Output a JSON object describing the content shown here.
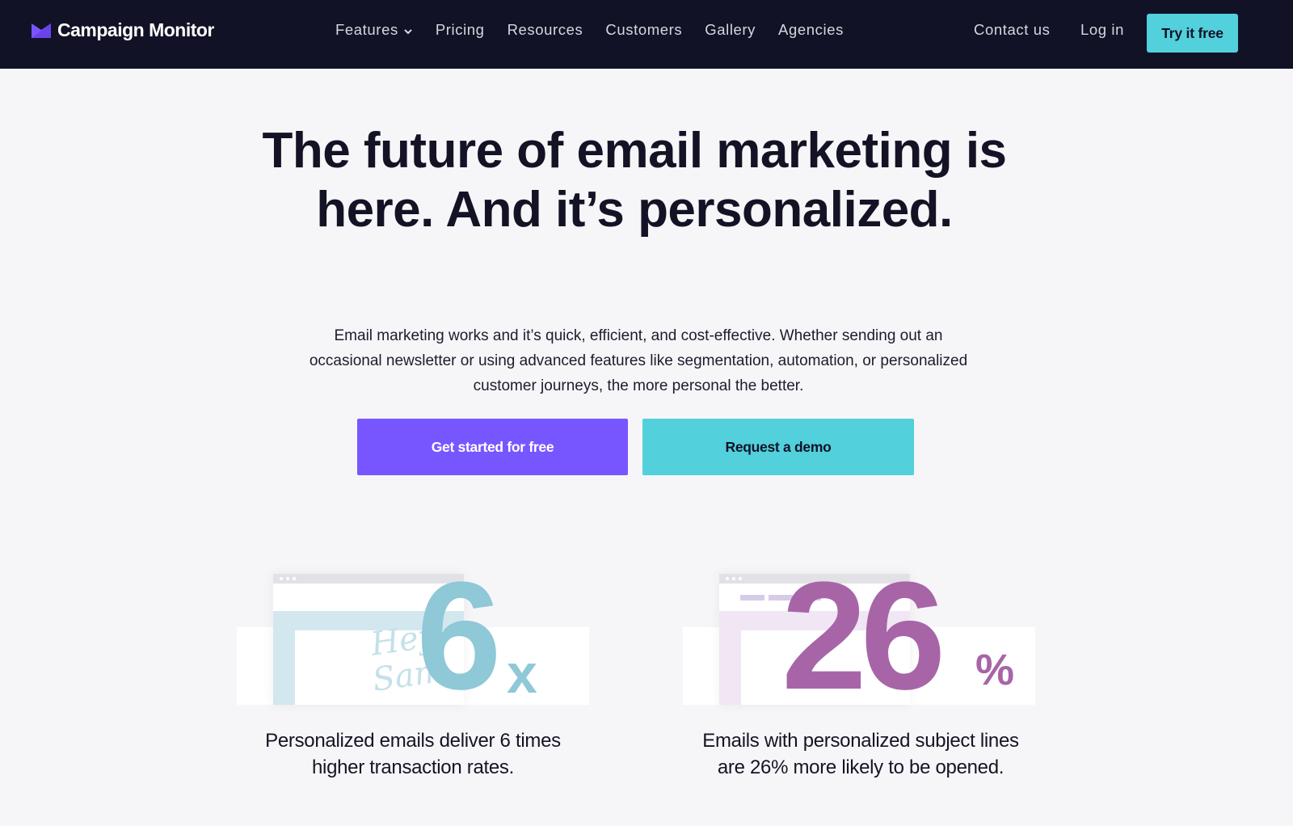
{
  "nav": {
    "brand": "Campaign Monitor",
    "links": [
      {
        "label": "Features",
        "has_dropdown": true
      },
      {
        "label": "Pricing"
      },
      {
        "label": "Resources"
      },
      {
        "label": "Customers"
      },
      {
        "label": "Gallery"
      },
      {
        "label": "Agencies"
      }
    ],
    "contact": "Contact us",
    "login": "Log in",
    "cta": "Try it free"
  },
  "hero": {
    "title": "The future of email marketing is here. And it’s personalized.",
    "subtitle": "Email marketing works and it’s quick, efficient, and cost-effective. Whether sending out an occasional newsletter or using advanced features like segmentation, automation, or personalized customer journeys, the more personal the better.",
    "primary_button": "Get started for free",
    "secondary_button": "Request a demo"
  },
  "stats": [
    {
      "number": "6",
      "suffix": "x",
      "illustration_text": "Hey Sam",
      "caption": "Personalized emails deliver 6 times higher transaction rates.",
      "color": "#8fc8d7"
    },
    {
      "number": "26",
      "suffix": "%",
      "caption": "Emails with personalized subject lines are 26% more likely to be opened.",
      "color": "#a765a8"
    }
  ],
  "colors": {
    "nav_bg": "#121226",
    "primary": "#7856ff",
    "accent": "#52d0dc",
    "page_bg": "#f6f6f9"
  }
}
